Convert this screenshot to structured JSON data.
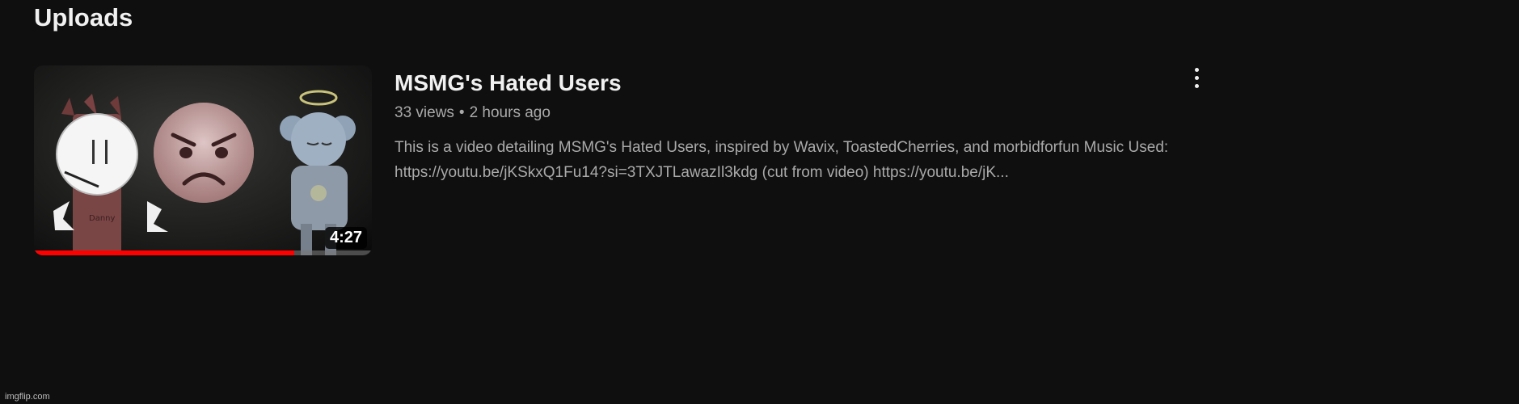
{
  "section": {
    "title": "Uploads"
  },
  "video": {
    "title": "MSMG's Hated Users",
    "views": "33 views",
    "separator": "•",
    "age": "2 hours ago",
    "description_line1": "This is a video detailing MSMG's Hated Users, inspired by Wavix, ToastedCherries, and morbidforfun Music Used:",
    "description_line2": "https://youtu.be/jKSkxQ1Fu14?si=3TXJTLawazIl3kdg (cut from video) https://youtu.be/jK...",
    "duration": "4:27",
    "watched_fraction": 0.77,
    "thumbnail": {
      "character_label": "Danny"
    }
  },
  "menu": {
    "icon": "more-vertical-icon"
  },
  "watermark": "imgflip.com",
  "colors": {
    "background": "#0f0f0f",
    "progress": "#ff0000",
    "text_primary": "#f1f1f1",
    "text_secondary": "#aaaaaa"
  }
}
